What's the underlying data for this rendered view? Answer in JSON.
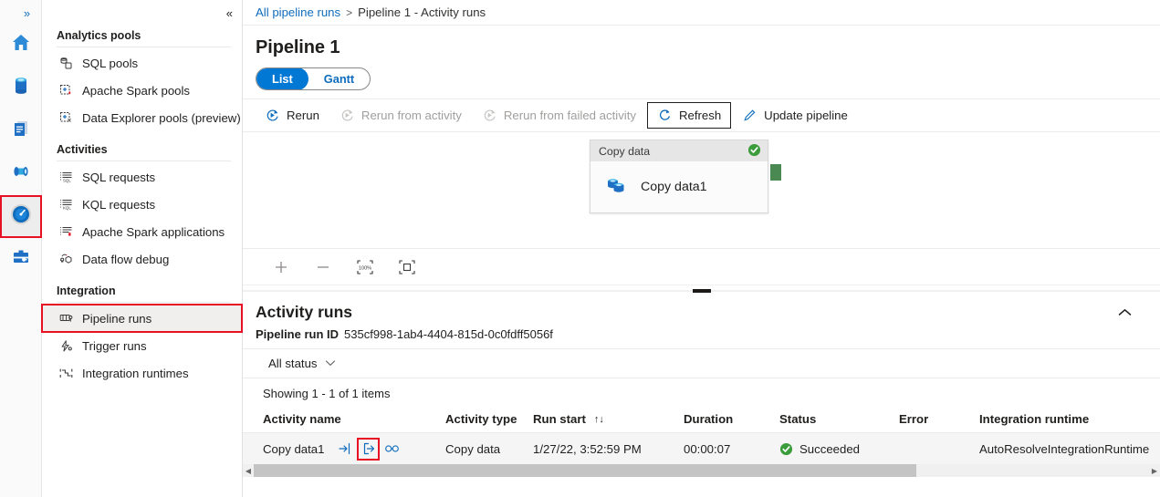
{
  "rail": {
    "expand_label": "»",
    "items": [
      {
        "name": "home",
        "icon": "home-icon"
      },
      {
        "name": "data",
        "icon": "database-icon"
      },
      {
        "name": "develop",
        "icon": "document-icon"
      },
      {
        "name": "integrate",
        "icon": "pipeline-spool-icon"
      },
      {
        "name": "monitor",
        "icon": "gauge-icon",
        "active": true
      },
      {
        "name": "manage",
        "icon": "toolbox-icon"
      }
    ]
  },
  "sidebar": {
    "collapse_label": "«",
    "groups": [
      {
        "title": "Analytics pools",
        "items": [
          {
            "label": "SQL pools",
            "icon": "sql-pool-icon"
          },
          {
            "label": "Apache Spark pools",
            "icon": "spark-pool-icon"
          },
          {
            "label": "Data Explorer pools (preview)",
            "icon": "data-explorer-pool-icon"
          }
        ]
      },
      {
        "title": "Activities",
        "items": [
          {
            "label": "SQL requests",
            "icon": "sql-request-icon"
          },
          {
            "label": "KQL requests",
            "icon": "kql-request-icon"
          },
          {
            "label": "Apache Spark applications",
            "icon": "spark-app-icon"
          },
          {
            "label": "Data flow debug",
            "icon": "data-flow-debug-icon"
          }
        ]
      },
      {
        "title": "Integration",
        "items": [
          {
            "label": "Pipeline runs",
            "icon": "pipeline-runs-icon",
            "highlight": true
          },
          {
            "label": "Trigger runs",
            "icon": "trigger-runs-icon"
          },
          {
            "label": "Integration runtimes",
            "icon": "integration-runtime-icon"
          }
        ]
      }
    ]
  },
  "breadcrumb": {
    "root": "All pipeline runs",
    "separator": ">",
    "current": "Pipeline 1 - Activity runs"
  },
  "page": {
    "title": "Pipeline 1"
  },
  "view_toggle": {
    "list": "List",
    "gantt": "Gantt",
    "selected": "List"
  },
  "toolbar": {
    "rerun": "Rerun",
    "rerun_from_activity": "Rerun from activity",
    "rerun_from_failed": "Rerun from failed activity",
    "refresh": "Refresh",
    "update_pipeline": "Update pipeline"
  },
  "canvas": {
    "node": {
      "header": "Copy data",
      "name": "Copy data1",
      "status": "succeeded"
    },
    "tools": {
      "zoom_in": "+",
      "zoom_out": "−",
      "zoom_level": "100%",
      "fit_to_screen": "Fit to screen"
    }
  },
  "activity_runs": {
    "title": "Activity runs",
    "run_id_label": "Pipeline run ID",
    "run_id_value": "535cf998-1ab4-4404-815d-0c0fdff5056f",
    "status_filter": "All status",
    "showing": "Showing 1 - 1 of 1 items",
    "columns": [
      "Activity name",
      "Activity type",
      "Run start",
      "Duration",
      "Status",
      "Error",
      "Integration runtime"
    ],
    "sort_indicator": "↑↓",
    "rows": [
      {
        "activity_name": "Copy data1",
        "activity_type": "Copy data",
        "run_start": "1/27/22, 3:52:59 PM",
        "duration": "00:00:07",
        "status": "Succeeded",
        "error": "",
        "integration_runtime": "AutoResolveIntegrationRuntime"
      }
    ],
    "row_action_icons": {
      "input": "input-arrow-icon",
      "output": "output-arrow-icon",
      "details": "glasses-details-icon"
    }
  },
  "colors": {
    "accent": "#0078d4",
    "link": "#0f6cbd",
    "highlight_red": "#e81123",
    "success_green": "#3b9c3b",
    "node_anchor_green": "#4a8a52"
  }
}
